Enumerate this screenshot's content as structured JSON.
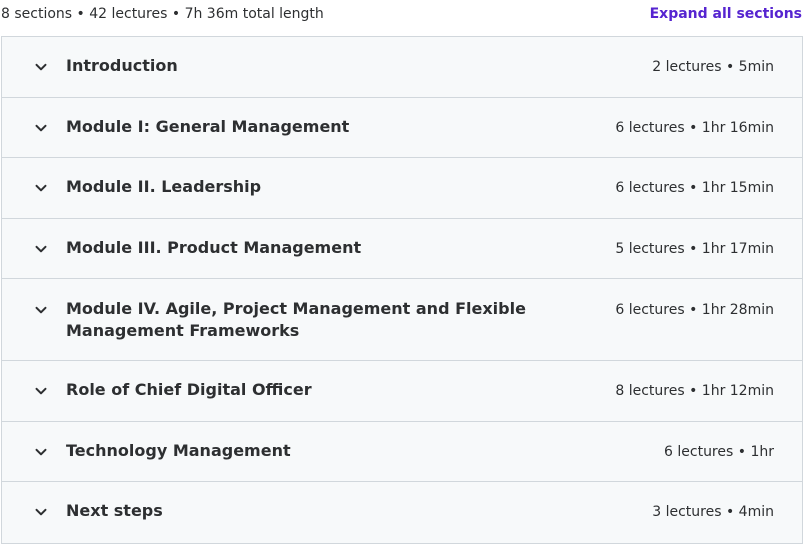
{
  "header": {
    "summary": "8 sections • 42 lectures • 7h 36m total length",
    "expand_all_label": "Expand all sections"
  },
  "sections": [
    {
      "title": "Introduction",
      "meta": "2 lectures • 5min"
    },
    {
      "title": "Module I: General Management",
      "meta": "6 lectures • 1hr 16min"
    },
    {
      "title": "Module II. Leadership",
      "meta": "6 lectures • 1hr 15min"
    },
    {
      "title": "Module III. Product Management",
      "meta": "5 lectures • 1hr 17min"
    },
    {
      "title": "Module IV. Agile, Project Management and Flexible Management Frameworks",
      "meta": "6 lectures • 1hr 28min"
    },
    {
      "title": "Role of Chief Digital Officer",
      "meta": "8 lectures • 1hr 12min"
    },
    {
      "title": "Technology Management",
      "meta": "6 lectures • 1hr"
    },
    {
      "title": "Next steps",
      "meta": "3 lectures • 4min"
    }
  ],
  "colors": {
    "accent": "#5624d0",
    "text": "#2d2f31",
    "row_background": "#f7f9fa",
    "border": "#d1d7dc"
  },
  "icons": {
    "section_toggle": "chevron-down-icon"
  }
}
